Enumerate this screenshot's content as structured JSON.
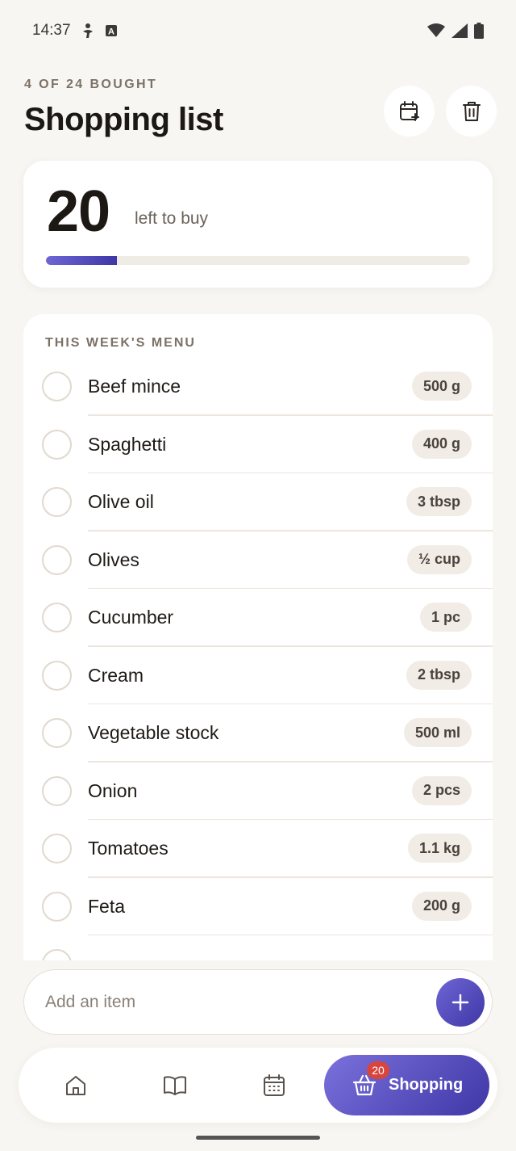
{
  "status_bar": {
    "time": "14:37",
    "icons": [
      "accessibility-icon",
      "a-box-icon",
      "wifi-icon",
      "signal-icon",
      "battery-icon"
    ]
  },
  "header": {
    "eyebrow": "4 OF 24 BOUGHT",
    "title": "Shopping list",
    "actions": [
      "calendar-add-icon",
      "trash-icon"
    ]
  },
  "summary": {
    "remaining": "20",
    "remaining_label": "left to buy",
    "progress_fraction": 0.1667
  },
  "list": {
    "section_title": "THIS WEEK'S MENU",
    "items": [
      {
        "name": "Beef mince",
        "qty": "500 g"
      },
      {
        "name": "Spaghetti",
        "qty": "400 g"
      },
      {
        "name": "Olive oil",
        "qty": "3 tbsp"
      },
      {
        "name": "Olives",
        "qty": "½ cup"
      },
      {
        "name": "Cucumber",
        "qty": "1 pc"
      },
      {
        "name": "Cream",
        "qty": "2 tbsp"
      },
      {
        "name": "Vegetable stock",
        "qty": "500 ml"
      },
      {
        "name": "Onion",
        "qty": "2 pcs"
      },
      {
        "name": "Tomatoes",
        "qty": "1.1 kg"
      },
      {
        "name": "Feta",
        "qty": "200 g"
      }
    ]
  },
  "add_item": {
    "placeholder": "Add an item"
  },
  "nav": {
    "items": [
      "home-icon",
      "book-icon",
      "calendar-icon"
    ],
    "active_label": "Shopping",
    "active_badge": "20"
  },
  "colors": {
    "background": "#f8f6f2",
    "accent_start": "#6f66d6",
    "accent_end": "#3f37a6",
    "badge": "#d8453d"
  }
}
